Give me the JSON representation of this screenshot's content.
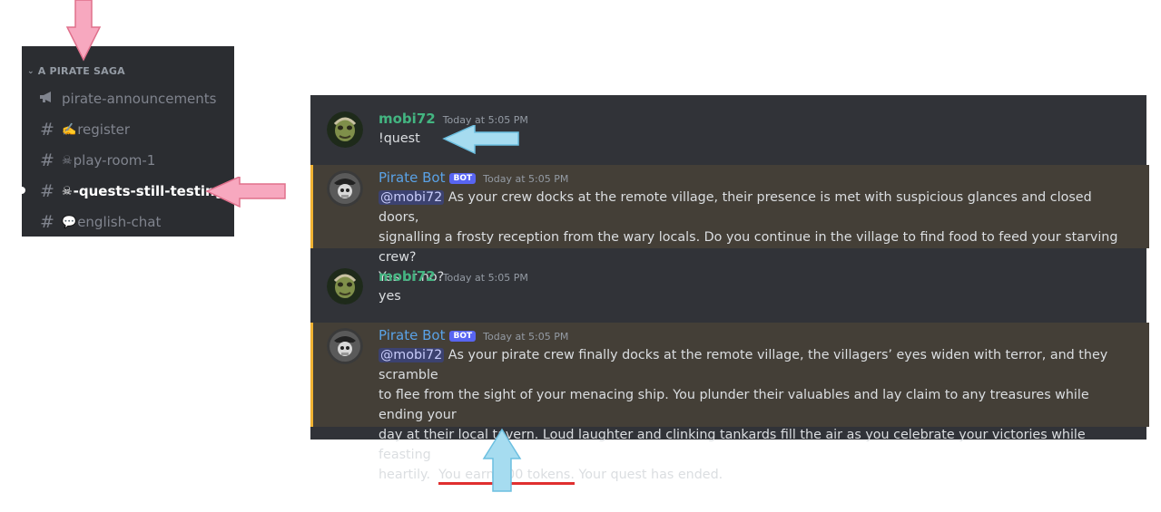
{
  "sidebar": {
    "category": "A PIRATE SAGA",
    "channels": [
      {
        "emoji": "",
        "label": "pirate-announcements",
        "icon": "megaphone-icon"
      },
      {
        "emoji": "✍️",
        "label": "register",
        "icon": "hash-icon"
      },
      {
        "emoji": "☠",
        "label": "play-room-1",
        "icon": "hash-icon"
      },
      {
        "emoji": "☠",
        "label": "-quests-still-testing",
        "icon": "hash-icon"
      },
      {
        "emoji": "💬",
        "label": "english-chat",
        "icon": "hash-icon"
      }
    ],
    "active_channel": "-quests-still-testing"
  },
  "messages": [
    {
      "author": "mobi72",
      "is_bot": false,
      "timestamp": "Today at 5:05 PM",
      "text": "!quest"
    },
    {
      "author": "Pirate Bot",
      "is_bot": true,
      "bot_tag": "BOT",
      "timestamp": "Today at 5:05 PM",
      "mention": "@mobi72",
      "text_line1": " As your crew docks at the remote village, their presence is met with suspicious glances and closed doors,",
      "text_line2": "signalling a frosty reception from the wary locals. Do you continue in the village to find food to feed your starving crew?",
      "text_line3": "Yes or no?"
    },
    {
      "author": "mobi72",
      "is_bot": false,
      "timestamp": "Today at 5:05 PM",
      "text": "yes"
    },
    {
      "author": "Pirate Bot",
      "is_bot": true,
      "bot_tag": "BOT",
      "timestamp": "Today at 5:05 PM",
      "mention": "@mobi72",
      "text_line1": " As your pirate crew finally docks at the remote village, the villagers’ eyes widen with terror, and they scramble",
      "text_line2": "to flee from the sight of your menacing ship. You plunder their valuables and lay claim to any treasures while ending your",
      "text_line3": "day at their local tavern. Loud laughter and clinking tankards fill the air as you celebrate your victories while feasting",
      "text_line4_pre": "heartily.  ",
      "text_line4_earn": "You earn 100 tokens.",
      "text_line4_post": " Your quest has ended."
    }
  ],
  "colors": {
    "sidebar_bg": "#2b2d31",
    "chat_bg": "#313338",
    "highlight_bg": "#443f37",
    "user_name": "#43b581",
    "bot_name": "#5aa2e6",
    "bot_tag": "#5865f2",
    "pink_arrow": "#f7a8bf",
    "blue_arrow": "#a6dcf0",
    "underline": "#e02f2f"
  }
}
